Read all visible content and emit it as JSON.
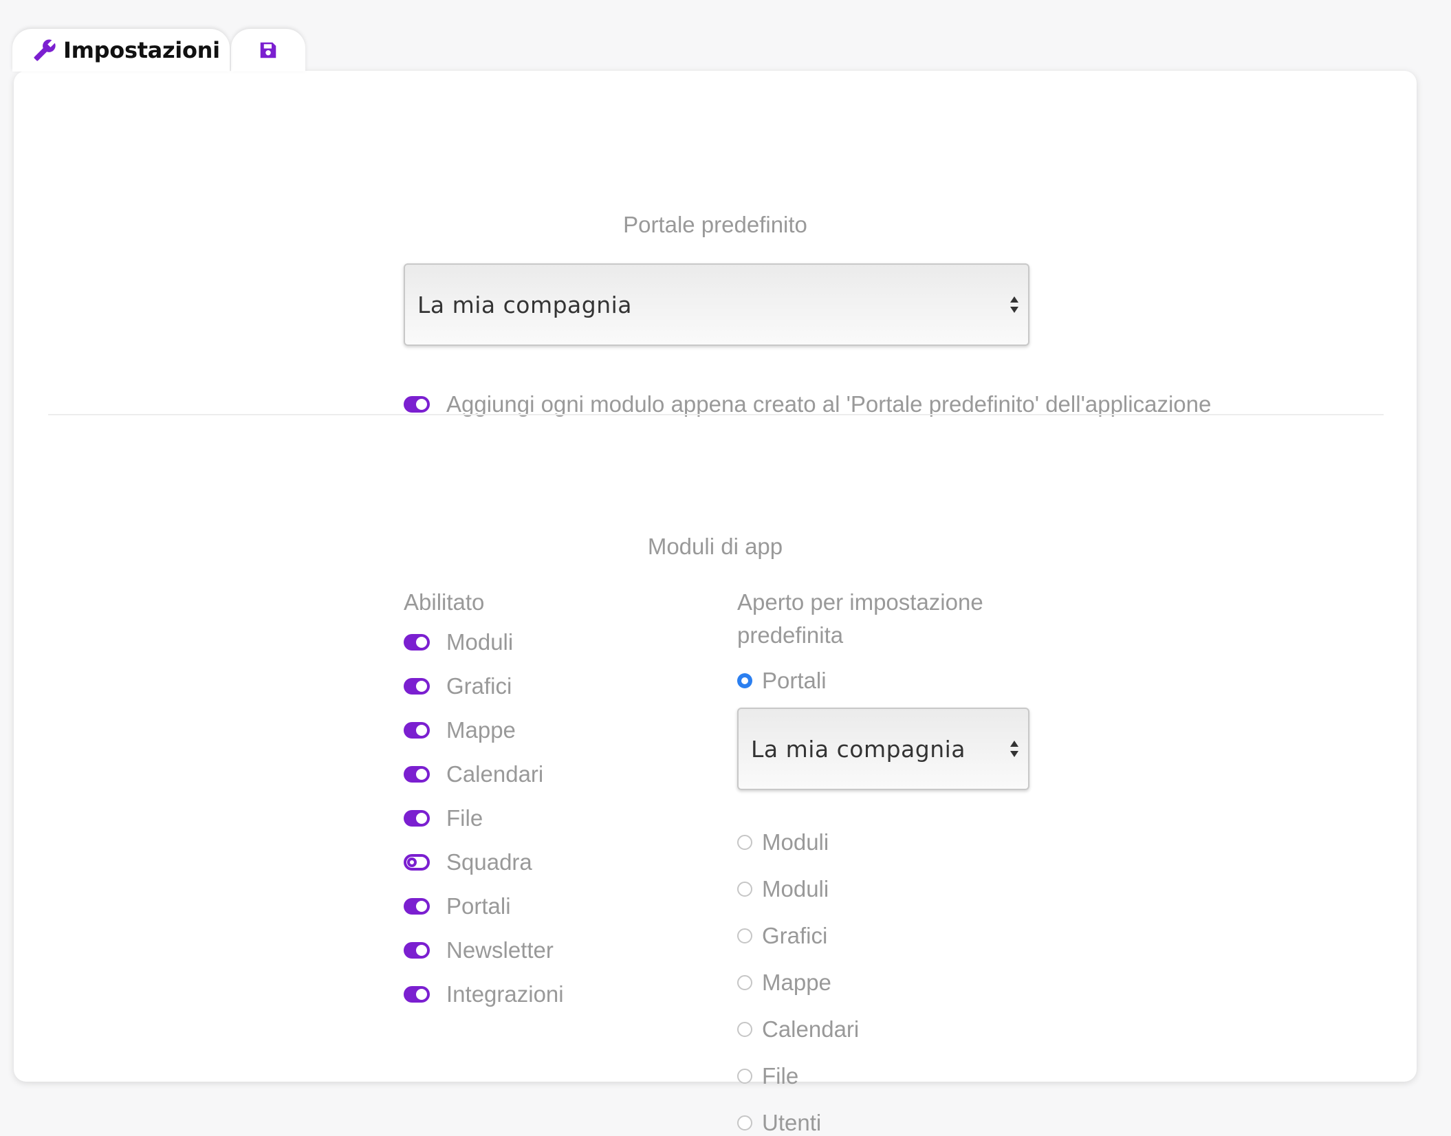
{
  "tabs": {
    "settings_label": "Impostazioni",
    "settings_icon": "wrench-icon",
    "save_icon": "floppy-disk-icon"
  },
  "default_portal": {
    "title": "Portale predefinito",
    "select_value": "La mia compagnia",
    "add_module_toggle": {
      "label": "Aggiungi ogni modulo appena creato al 'Portale predefinito' dell'applicazione",
      "on": true
    }
  },
  "app_modules": {
    "title": "Moduli di app",
    "enabled_header": "Abilitato",
    "enabled_items": [
      {
        "label": "Moduli",
        "state": "on"
      },
      {
        "label": "Grafici",
        "state": "on"
      },
      {
        "label": "Mappe",
        "state": "on"
      },
      {
        "label": "Calendari",
        "state": "on"
      },
      {
        "label": "File",
        "state": "on"
      },
      {
        "label": "Squadra",
        "state": "partial"
      },
      {
        "label": "Portali",
        "state": "on"
      },
      {
        "label": "Newsletter",
        "state": "on"
      },
      {
        "label": "Integrazioni",
        "state": "on"
      }
    ],
    "default_open_header": "Aperto per impostazione predefinita",
    "default_open_selected": {
      "label": "Portali"
    },
    "portal_select_value": "La mia compagnia",
    "default_open_options": [
      {
        "label": "Moduli"
      },
      {
        "label": "Moduli"
      },
      {
        "label": "Grafici"
      },
      {
        "label": "Mappe"
      },
      {
        "label": "Calendari"
      },
      {
        "label": "File"
      },
      {
        "label": "Utenti"
      }
    ]
  },
  "colors": {
    "accent": "#7b1fd0",
    "radio_selected": "#2b7ff0",
    "muted_text": "#999999"
  }
}
